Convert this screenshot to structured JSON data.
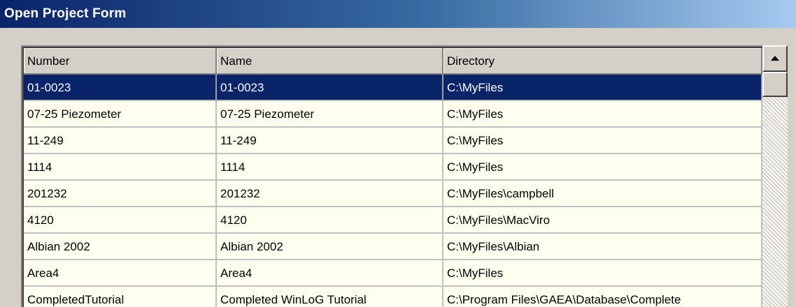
{
  "window": {
    "title": "Open Project Form"
  },
  "grid": {
    "columns": [
      "Number",
      "Name",
      "Directory"
    ],
    "rows": [
      [
        "01-0023",
        "01-0023",
        "C:\\MyFiles"
      ],
      [
        "07-25 Piezometer",
        "07-25 Piezometer",
        "C:\\MyFiles"
      ],
      [
        "11-249",
        "11-249",
        "C:\\MyFiles"
      ],
      [
        "1114",
        "1114",
        "C:\\MyFiles"
      ],
      [
        "201232",
        "201232",
        "C:\\MyFiles\\campbell"
      ],
      [
        "4120",
        "4120",
        "C:\\MyFiles\\MacViro"
      ],
      [
        "Albian 2002",
        "Albian 2002",
        "C:\\MyFiles\\Albian"
      ],
      [
        "Area4",
        "Area4",
        "C:\\MyFiles"
      ],
      [
        "CompletedTutorial",
        "Completed WinLoG Tutorial",
        "C:\\Program Files\\GAEA\\Database\\Complete"
      ]
    ],
    "selected_row": 0
  },
  "scrollbar": {
    "up_icon": "arrow-up-icon"
  },
  "colors": {
    "title_bar_start": "#0a246a",
    "selected_row": "#0a246a",
    "grid_background": "#fffff0",
    "header_background": "#d4d0c8"
  }
}
